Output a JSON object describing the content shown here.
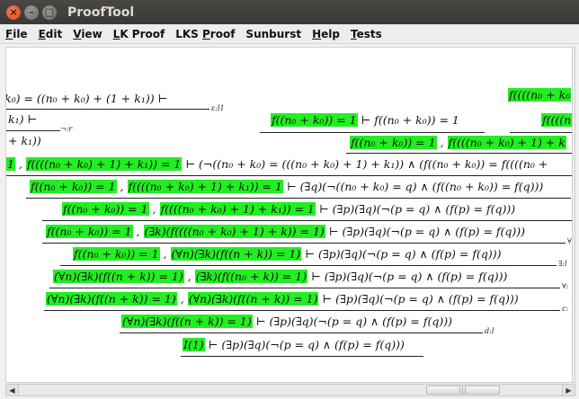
{
  "window": {
    "title": "ProofTool"
  },
  "menu": [
    {
      "pre": "",
      "u": "F",
      "post": "ile"
    },
    {
      "pre": "",
      "u": "E",
      "post": "dit"
    },
    {
      "pre": "",
      "u": "V",
      "post": "iew"
    },
    {
      "pre": "",
      "u": "L",
      "post": "K Proof"
    },
    {
      "pre": "LKS ",
      "u": "P",
      "post": "roof"
    },
    {
      "pre": "Sunburst",
      "u": "",
      "post": ""
    },
    {
      "pre": "",
      "u": "H",
      "post": "elp"
    },
    {
      "pre": "",
      "u": "T",
      "post": "ests"
    }
  ],
  "proof": {
    "top_left_1": "k₀) = ((n₀ + k₀) + (1 + k₁)) ⊢",
    "top_left_1_label": "ε:l1",
    "top_left_2": "k₁) ⊢",
    "top_left_2_label": "¬:r",
    "top_left_3": "+ k₁))",
    "top_right_1": "f((((n₀ + k₀",
    "mid_hl_1": "f((n₀ + k₀)) = 1",
    "mid_rest_1": " ⊢ f((n₀ + k₀)) = 1",
    "mid_right_1": "f((((n",
    "row3_hl_a": "f((n₀ + k₀)) = 1",
    "row3_hl_b": "f((((n₀ + k₀) + 1) + k",
    "row4_hl_a": "1",
    "row4_hl_b": "f((((n₀ + k₀) + 1) + k₁)) = 1",
    "row4_rest": "⊢ (¬((n₀ + k₀) = (((n₀ + k₀) + 1) + k₁)) ∧ (f((n₀ + k₀)) = f((((n₀ +",
    "row5_hl_a": "f((n₀ + k₀)) = 1",
    "row5_hl_b": "f((((n₀ + k₀) + 1) + k₁)) = 1",
    "row5_rest": "⊢ (∃q)(¬((n₀ + k₀) = q) ∧ (f((n₀ + k₀)) = f(q)))",
    "row6_hl_a": "f((n₀ + k₀)) = 1",
    "row6_hl_b": "f((((n₀ + k₀) + 1) + k₁)) = 1",
    "row6_rest": "⊢ (∃p)(∃q)(¬(p = q) ∧ (f(p) = f(q)))",
    "row7_hl_a": "f((n₀ + k₀)) = 1",
    "row7_hl_b": "(∃k)(f((((n₀ + k₀) + 1) + k)) = 1)",
    "row7_rest": "⊢ (∃p)(∃q)(¬(p = q) ∧ (f(p) = f(q)))",
    "row7_label": "∀:",
    "row8_hl_a": "f((n₀ + k₀)) = 1",
    "row8_hl_b": "(∀n)(∃k)(f((n + k)) = 1)",
    "row8_rest": "⊢ (∃p)(∃q)(¬(p = q) ∧ (f(p) = f(q)))",
    "row8_label": "∃:l",
    "row9_hl_a": "(∀n)(∃k)(f((n + k)) = 1)",
    "row9_hl_b": "(∃k)(f((n₀ + k)) = 1)",
    "row9_rest": "⊢ (∃p)(∃q)(¬(p = q) ∧ (f(p) = f(q)))",
    "row9_label": "∀:",
    "row10_hl_a": "(∀n)(∃k)(f((n + k)) = 1)",
    "row10_hl_b": "(∀n)(∃k)(f((n + k)) = 1)",
    "row10_rest": "⊢ (∃p)(∃q)(¬(p = q) ∧ (f(p) = f(q)))",
    "row10_label": "c:",
    "row11_hl": "(∀n)(∃k)(f((n + k)) = 1)",
    "row11_rest": "⊢ (∃p)(∃q)(¬(p = q) ∧ (f(p) = f(q)))",
    "row11_label": "d:l",
    "row12_hl": "I(1)",
    "row12_rest": "⊢ (∃p)(∃q)(¬(p = q) ∧ (f(p) = f(q)))"
  },
  "highlight_color": "#22ee22"
}
